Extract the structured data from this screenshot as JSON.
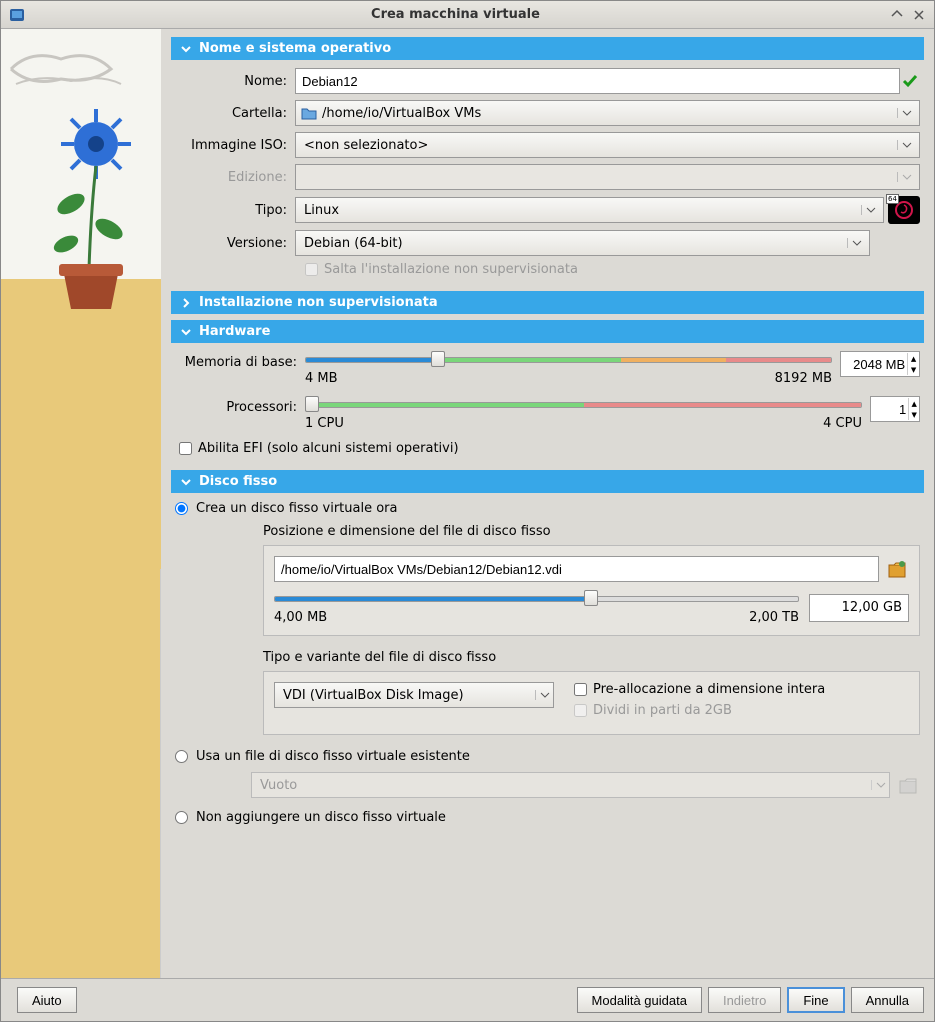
{
  "window": {
    "title": "Crea macchina virtuale"
  },
  "sections": {
    "name": "Nome e sistema operativo",
    "unattended": "Installazione non supervisionata",
    "hardware": "Hardware",
    "disk": "Disco fisso"
  },
  "labels": {
    "name": "Nome:",
    "folder": "Cartella:",
    "iso": "Immagine ISO:",
    "edition": "Edizione:",
    "type": "Tipo:",
    "version": "Versione:",
    "skip": "Salta l'installazione non supervisionata",
    "memory": "Memoria di base:",
    "cpus": "Processori:",
    "efi": "Abilita EFI (solo alcuni sistemi operativi)",
    "disk_create": "Crea un disco fisso virtuale ora",
    "disk_pos": "Posizione e dimensione del file di disco fisso",
    "disk_type": "Tipo e variante del file di disco fisso",
    "prealloc": "Pre-allocazione a dimensione intera",
    "split": "Dividi in parti da 2GB",
    "disk_existing": "Usa un file di disco fisso virtuale esistente",
    "disk_none": "Non aggiungere un disco fisso virtuale",
    "empty": "Vuoto"
  },
  "values": {
    "name": "Debian12",
    "folder": "/home/io/VirtualBox VMs",
    "iso": "<non selezionato>",
    "type": "Linux",
    "version": "Debian (64-bit)",
    "memory": "2048 MB",
    "mem_min": "4 MB",
    "mem_max": "8192 MB",
    "cpus": "1",
    "cpu_min": "1 CPU",
    "cpu_max": "4 CPU",
    "disk_path": "/home/io/VirtualBox VMs/Debian12/Debian12.vdi",
    "disk_size": "12,00 GB",
    "disk_min": "4,00 MB",
    "disk_max": "2,00 TB",
    "disk_format": "VDI (VirtualBox Disk Image)"
  },
  "footer": {
    "help": "Aiuto",
    "guided": "Modalità guidata",
    "back": "Indietro",
    "finish": "Fine",
    "cancel": "Annulla"
  }
}
